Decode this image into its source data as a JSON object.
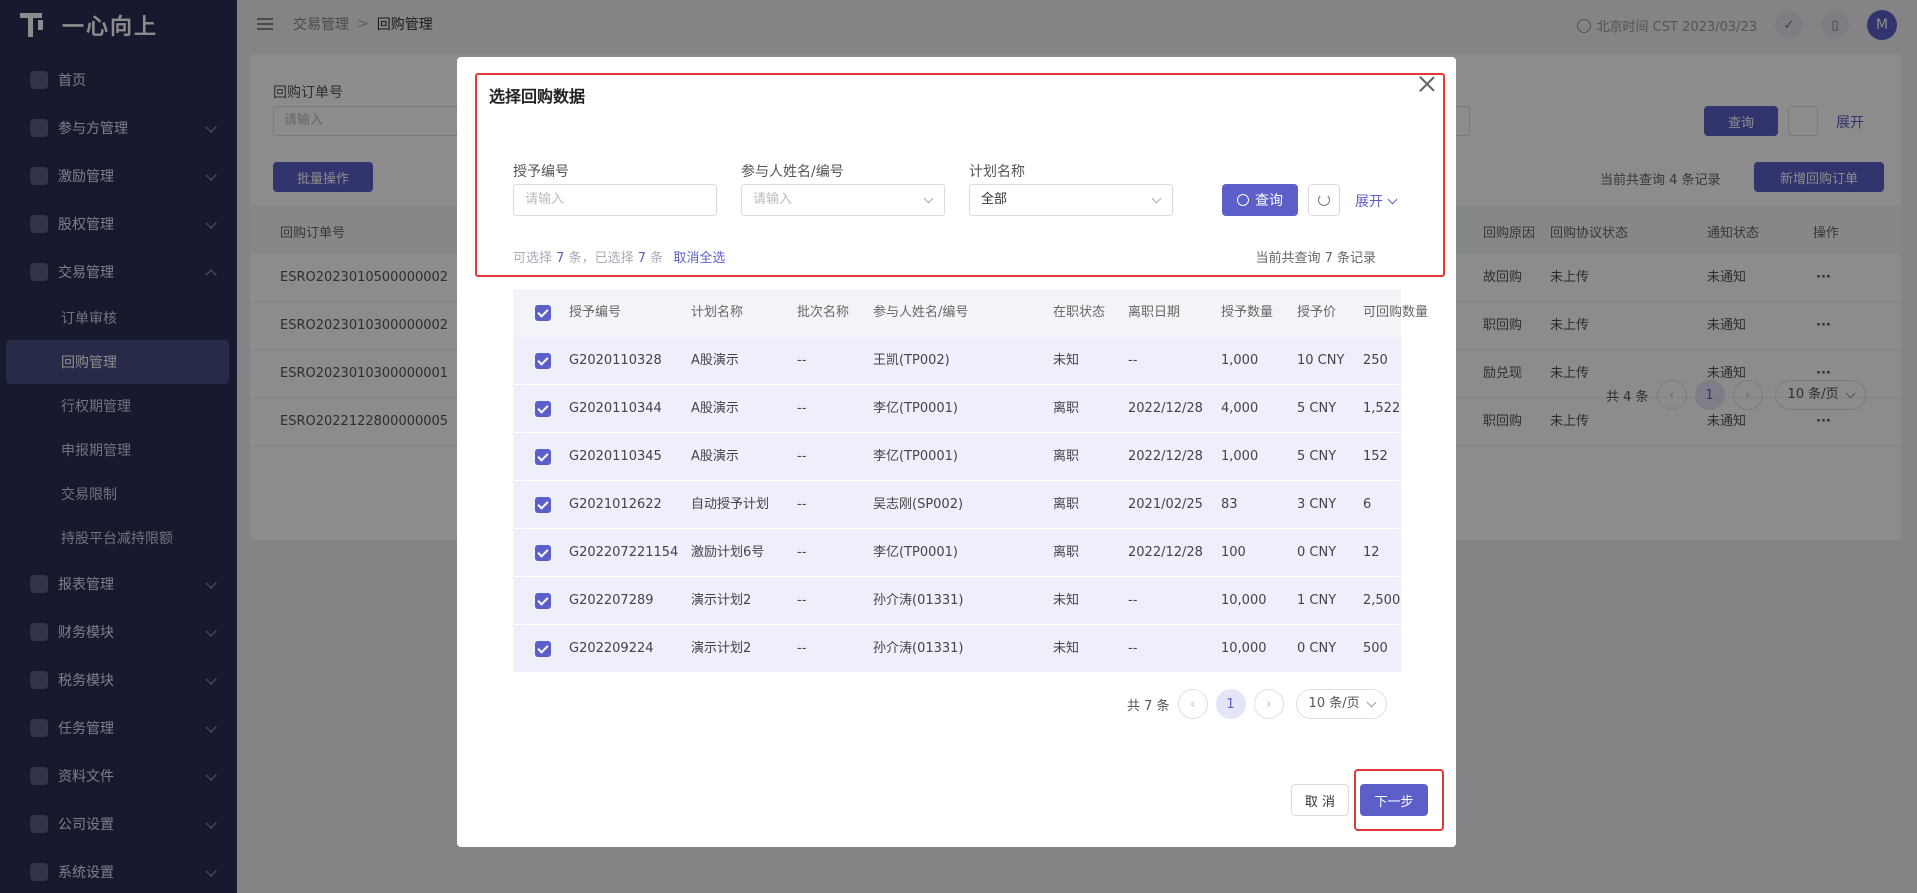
{
  "app": {
    "logo_text": "一心向上"
  },
  "sidebar": {
    "items": [
      {
        "label": "首页",
        "icon": "home-icon",
        "expandable": false
      },
      {
        "label": "参与方管理",
        "icon": "users-icon",
        "expandable": true
      },
      {
        "label": "激励管理",
        "icon": "gift-icon",
        "expandable": true
      },
      {
        "label": "股权管理",
        "icon": "pie-chart-icon",
        "expandable": true
      },
      {
        "label": "交易管理",
        "icon": "shield-icon",
        "expandable": true,
        "open": true
      }
    ],
    "sub_items": [
      {
        "label": "订单审核",
        "active": false
      },
      {
        "label": "回购管理",
        "active": true
      },
      {
        "label": "行权期管理",
        "active": false
      },
      {
        "label": "申报期管理",
        "active": false
      },
      {
        "label": "交易限制",
        "active": false
      },
      {
        "label": "持股平台减持限额",
        "active": false
      }
    ],
    "items_after": [
      {
        "label": "报表管理",
        "icon": "report-icon"
      },
      {
        "label": "财务模块",
        "icon": "finance-icon"
      },
      {
        "label": "税务模块",
        "icon": "tax-icon"
      },
      {
        "label": "任务管理",
        "icon": "task-icon"
      },
      {
        "label": "资料文件",
        "icon": "folder-icon"
      },
      {
        "label": "公司设置",
        "icon": "company-icon"
      },
      {
        "label": "系统设置",
        "icon": "settings-icon"
      }
    ]
  },
  "topbar": {
    "breadcrumb": [
      "交易管理",
      "回购管理"
    ],
    "breadcrumb_sep": ">",
    "time_text": "北京时间 CST 2023/03/23",
    "avatar_letter": "M"
  },
  "background": {
    "filter_label": "回购订单号",
    "filter_placeholder": "请输入",
    "query_label": "查询",
    "expand_label": "展开",
    "batch_label": "批量操作",
    "record_info": "当前共查询 4 条记录",
    "add_label": "新增回购订单",
    "columns": [
      "回购订单号",
      "回购原因",
      "回购协议状态",
      "通知状态",
      "操作"
    ],
    "rows": [
      {
        "id": "ESRO2023010500000002",
        "reason": "故回购",
        "agreement": "未上传",
        "notice": "未通知"
      },
      {
        "id": "ESRO2023010300000002",
        "reason": "职回购",
        "agreement": "未上传",
        "notice": "未通知"
      },
      {
        "id": "ESRO2023010300000001",
        "reason": "励兑现",
        "agreement": "未上传",
        "notice": "未通知"
      },
      {
        "id": "ESRO2022122800000005",
        "reason": "职回购",
        "agreement": "未上传",
        "notice": "未通知"
      }
    ],
    "more": "···",
    "pagination": {
      "total": "共 4 条",
      "page": "1",
      "size": "10 条/页"
    }
  },
  "modal": {
    "title": "选择回购数据",
    "filters": {
      "grant_no": {
        "label": "授予编号",
        "placeholder": "请输入"
      },
      "participant": {
        "label": "参与人姓名/编号",
        "placeholder": "请输入"
      },
      "plan": {
        "label": "计划名称",
        "value": "全部"
      }
    },
    "query_label": "查询",
    "expand_label": "展开",
    "selectable_prefix": "可选择",
    "selectable_count": "7",
    "selected_mid": "条，已选择",
    "selected_count": "7",
    "selected_suffix": "条",
    "cancel_all": "取消全选",
    "total_info": "当前共查询 7 条记录",
    "columns": [
      "授予编号",
      "计划名称",
      "批次名称",
      "参与人姓名/编号",
      "在职状态",
      "离职日期",
      "授予数量",
      "授予价",
      "可回购数量"
    ],
    "rows": [
      [
        "G2020110328",
        "A股演示",
        "--",
        "王凯(TP002)",
        "未知",
        "--",
        "1,000",
        "10 CNY",
        "250"
      ],
      [
        "G2020110344",
        "A股演示",
        "--",
        "李亿(TP0001)",
        "离职",
        "2022/12/28",
        "4,000",
        "5 CNY",
        "1,522"
      ],
      [
        "G2020110345",
        "A股演示",
        "--",
        "李亿(TP0001)",
        "离职",
        "2022/12/28",
        "1,000",
        "5 CNY",
        "152"
      ],
      [
        "G2021012622",
        "自动授予计划",
        "--",
        "吴志刚(SP002)",
        "离职",
        "2021/02/25",
        "83",
        "3 CNY",
        "6"
      ],
      [
        "G202207221154",
        "激励计划6号",
        "--",
        "李亿(TP0001)",
        "离职",
        "2022/12/28",
        "100",
        "0 CNY",
        "12"
      ],
      [
        "G202207289",
        "演示计划2",
        "--",
        "孙介涛(01331)",
        "未知",
        "--",
        "10,000",
        "1 CNY",
        "2,500"
      ],
      [
        "G202209224",
        "演示计划2",
        "--",
        "孙介涛(01331)",
        "未知",
        "--",
        "10,000",
        "0 CNY",
        "500"
      ]
    ],
    "pagination": {
      "total": "共 7 条",
      "page": "1",
      "size": "10 条/页"
    },
    "cancel_label": "取 消",
    "next_label": "下一步"
  },
  "colors": {
    "accent": "#5b5fc7",
    "sidebar": "#2b2e57",
    "highlight": "#e23a3a"
  }
}
